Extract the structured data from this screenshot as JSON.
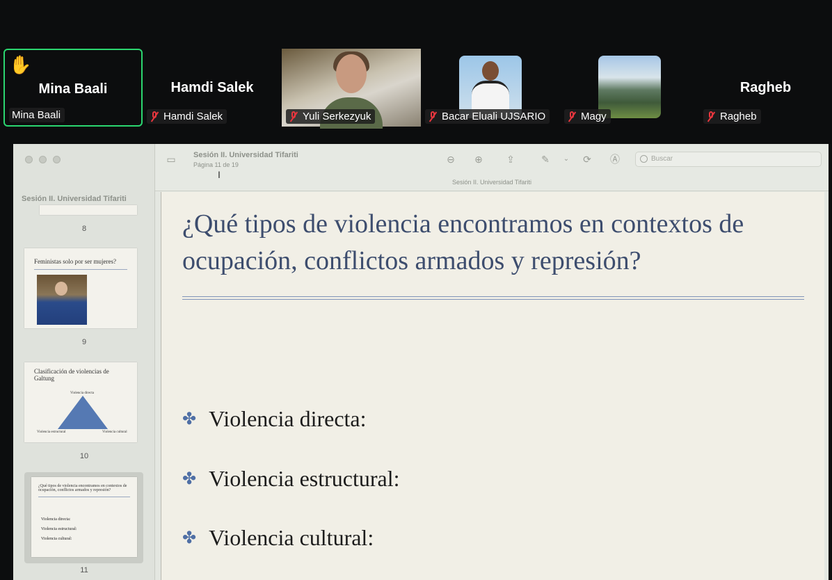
{
  "participants": [
    {
      "name": "Mina Baali",
      "label": "Mina Baali",
      "raised_hand": true,
      "muted": false
    },
    {
      "name": "Hamdi Salek",
      "label": "Hamdi Salek",
      "muted": true
    },
    {
      "label": "Yuli Serkezyuk",
      "muted": true
    },
    {
      "label": "Bacar Eluali UJSARIO",
      "muted": true
    },
    {
      "label": "Magy",
      "muted": true
    },
    {
      "name": "Ragheb",
      "label": "Ragheb",
      "muted": true
    }
  ],
  "viewer": {
    "doc_title": "Sesión II. Universidad Tifariti",
    "page_indicator": "Página 11 de 19",
    "subtitle": "Sesión II. Universidad Tifariti",
    "search_placeholder": "Buscar",
    "sidebar_title": "Sesión II. Universidad Tifariti"
  },
  "thumbnails": [
    {
      "number": "8"
    },
    {
      "number": "9",
      "title": "Feministas solo por ser mujeres?"
    },
    {
      "number": "10",
      "title": "Clasificación de violencias de Galtung",
      "top_label": "Violencia directa",
      "left_label": "Violencia estructural",
      "right_label": "Violencia cultural"
    },
    {
      "number": "11",
      "title": "¿Qué tipos de violencia encontramos en contextos de ocupación, conflictos armados y represión?",
      "bullets": [
        "Violencia directa:",
        "Violencia estructural:",
        "Violencia cultural:"
      ]
    }
  ],
  "slide": {
    "title": "¿Qué tipos de violencia encontramos en contextos de ocupación, conflictos armados y represión?",
    "bullets": [
      "Violencia directa:",
      "Violencia estructural:",
      "Violencia cultural:"
    ]
  },
  "colors": {
    "active_speaker": "#2bd670",
    "muted_mic": "#e8363e",
    "slide_title": "#3d4d6e",
    "accent": "#4f6fa5"
  }
}
